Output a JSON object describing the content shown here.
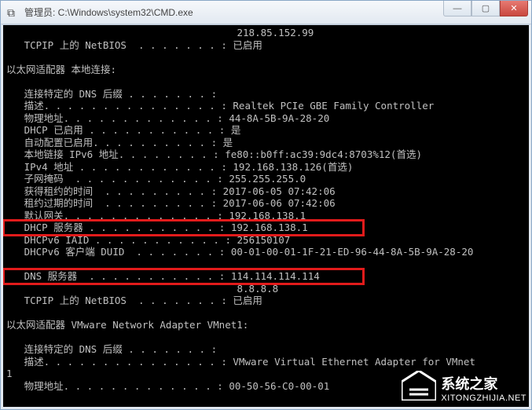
{
  "window": {
    "title": "管理员: C:\\Windows\\system32\\CMD.exe",
    "icon": "⧉"
  },
  "sysbtn": {
    "min": "—",
    "max": "▢",
    "close": "✕"
  },
  "ip_top": "218.85.152.99",
  "netbios_label": "TCPIP 上的 NetBIOS  . . . . . . . :",
  "netbios_value": "已启用",
  "adapter_local_header": "以太网适配器 本地连接:",
  "lines": {
    "dns_suffix": {
      "label": "连接特定的 DNS 后缀 . . . . . . . :",
      "value": ""
    },
    "description": {
      "label": "描述. . . . . . . . . . . . . . . :",
      "value": "Realtek PCIe GBE Family Controller"
    },
    "physaddr": {
      "label": "物理地址. . . . . . . . . . . . . :",
      "value": "44-8A-5B-9A-28-20"
    },
    "dhcp_enabled": {
      "label": "DHCP 已启用 . . . . . . . . . . . :",
      "value": "是"
    },
    "autoconfig": {
      "label": "自动配置已启用. . . . . . . . . . :",
      "value": "是"
    },
    "link_ipv6": {
      "label": "本地链接 IPv6 地址. . . . . . . . :",
      "value": "fe80::b0ff:ac39:9dc4:8703%12(首选)"
    },
    "ipv4": {
      "label": "IPv4 地址 . . . . . . . . . . . . :",
      "value": "192.168.138.126(首选)"
    },
    "subnet": {
      "label": "子网掩码  . . . . . . . . . . . . :",
      "value": "255.255.255.0"
    },
    "lease_obt": {
      "label": "获得租约的时间  . . . . . . . . . :",
      "value": "2017-06-05 07:42:06"
    },
    "lease_exp": {
      "label": "租约过期的时间  . . . . . . . . . :",
      "value": "2017-06-06 07:42:06"
    },
    "default_gw": {
      "label": "默认网关. . . . . . . . . . . . . :",
      "value": "192.168.138.1"
    },
    "dhcp_server": {
      "label": "DHCP 服务器 . . . . . . . . . . . :",
      "value": "192.168.138.1"
    },
    "dhcpv6_iaid": {
      "label": "DHCPv6 IAID . . . . . . . . . . . :",
      "value": "256150107"
    },
    "dhcpv6_duid": {
      "label": "DHCPv6 客户端 DUID  . . . . . . . :",
      "value": "00-01-00-01-1F-21-ED-96-44-8A-5B-9A-28-20"
    },
    "dns_servers": {
      "label": "DNS 服务器  . . . . . . . . . . . :",
      "value": "114.114.114.114"
    },
    "dns_alt": "8.8.8.8",
    "netbios2": {
      "label": "TCPIP 上的 NetBIOS  . . . . . . . :",
      "value": "已启用"
    }
  },
  "adapter_vmnet_header": "以太网适配器 VMware Network Adapter VMnet1:",
  "vmnet": {
    "dns_suffix": {
      "label": "连接特定的 DNS 后缀 . . . . . . . :",
      "value": ""
    },
    "description": {
      "label": "描述. . . . . . . . . . . . . . . :",
      "value": "VMware Virtual Ethernet Adapter for VMnet"
    },
    "extra": "1",
    "physaddr": {
      "label": "物理地址. . . . . . . . . . . . . :",
      "value": "00-50-56-C0-00-01"
    }
  },
  "watermark": {
    "name": "系统之家",
    "url": "XITONGZHIJIA.NET"
  }
}
